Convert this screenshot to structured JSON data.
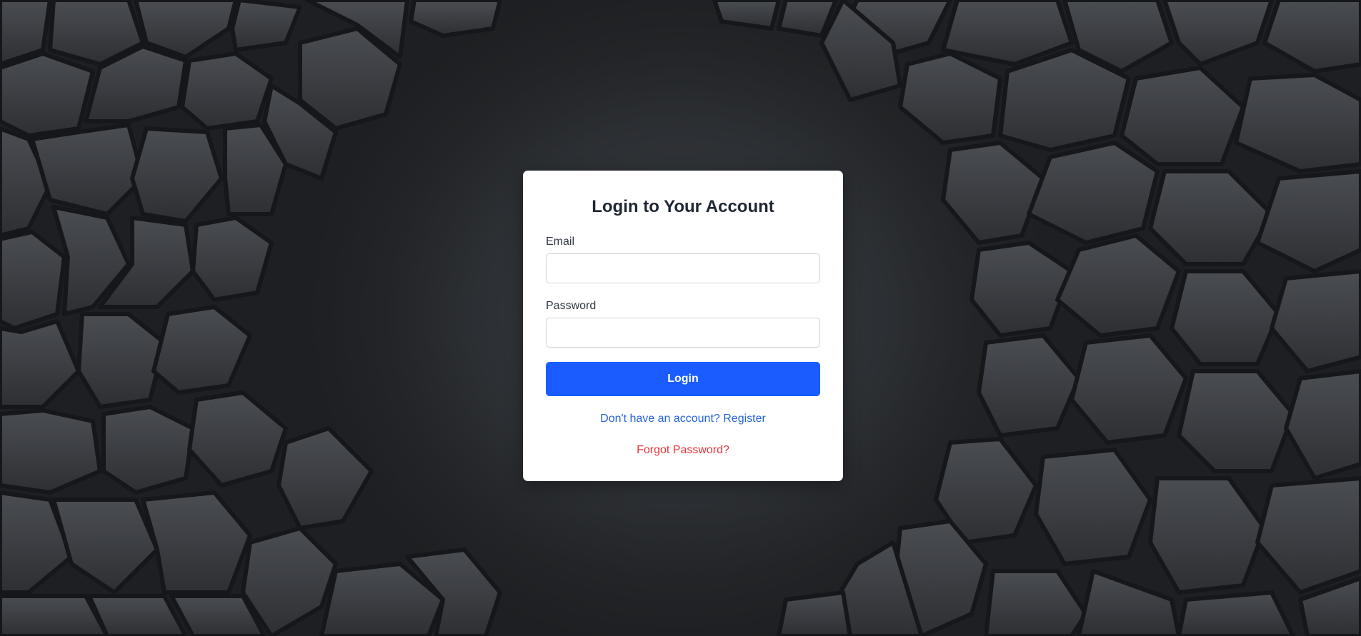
{
  "login": {
    "title": "Login to Your Account",
    "email_label": "Email",
    "email_value": "",
    "password_label": "Password",
    "password_value": "",
    "submit_label": "Login",
    "register_link": "Don't have an account? Register",
    "forgot_link": "Forgot Password?"
  },
  "colors": {
    "accent": "#1a5cff",
    "link": "#2563d9",
    "danger": "#e8343b",
    "background": "#2c2f33"
  }
}
